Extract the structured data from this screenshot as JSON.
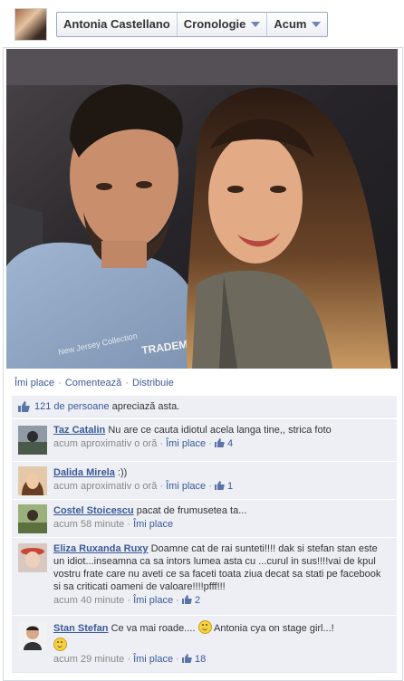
{
  "header": {
    "profile_name": "Antonia Castellano",
    "timeline_label": "Cronologie",
    "now_label": "Acum"
  },
  "photo": {
    "shirt_text": "TRADEMARK",
    "shirt_text2": "New Jersey Collection"
  },
  "actions": {
    "like": "Îmi place",
    "comment": "Comentează",
    "share": "Distribuie",
    "separator": "·"
  },
  "likes": {
    "count_link": "121 de persoane",
    "suffix": "apreciază asta."
  },
  "comments": [
    {
      "author": "Taz Catalin",
      "text": "Nu are ce cauta idiotul acela langa tine,, strica foto",
      "time": "acum aproximativ o oră",
      "like_label": "Îmi place",
      "like_count": "4"
    },
    {
      "author": "Dalida Mirela",
      "text": ":))",
      "time": "acum aproximativ o oră",
      "like_label": "Îmi place",
      "like_count": "1"
    },
    {
      "author": "Costel Stoicescu",
      "text": "pacat de frumusetea ta...",
      "time": "acum 58 minute",
      "like_label": "Îmi place",
      "like_count": ""
    },
    {
      "author": "Eliza Ruxanda Ruxy",
      "text": "Doamne cat de rai sunteti!!!! dak si stefan stan este un idiot...inseamna ca sa intors lumea asta cu ...curul in sus!!!!vai de kpul vostru frate care nu aveti ce sa faceti toata ziua decat sa stati pe facebook si sa criticati oameni de valoare!!!!pfff!!!",
      "time": "acum 40 minute",
      "like_label": "Îmi place",
      "like_count": "2"
    },
    {
      "author": "Stan Stefan",
      "text_before": "Ce va mai roade....",
      "text_after": "Antonia cya on stage girl...!",
      "time": "acum 29 minute",
      "like_label": "Îmi place",
      "like_count": "18"
    }
  ],
  "colors": {
    "link": "#3b5998",
    "comment_bg": "#edeff4"
  }
}
